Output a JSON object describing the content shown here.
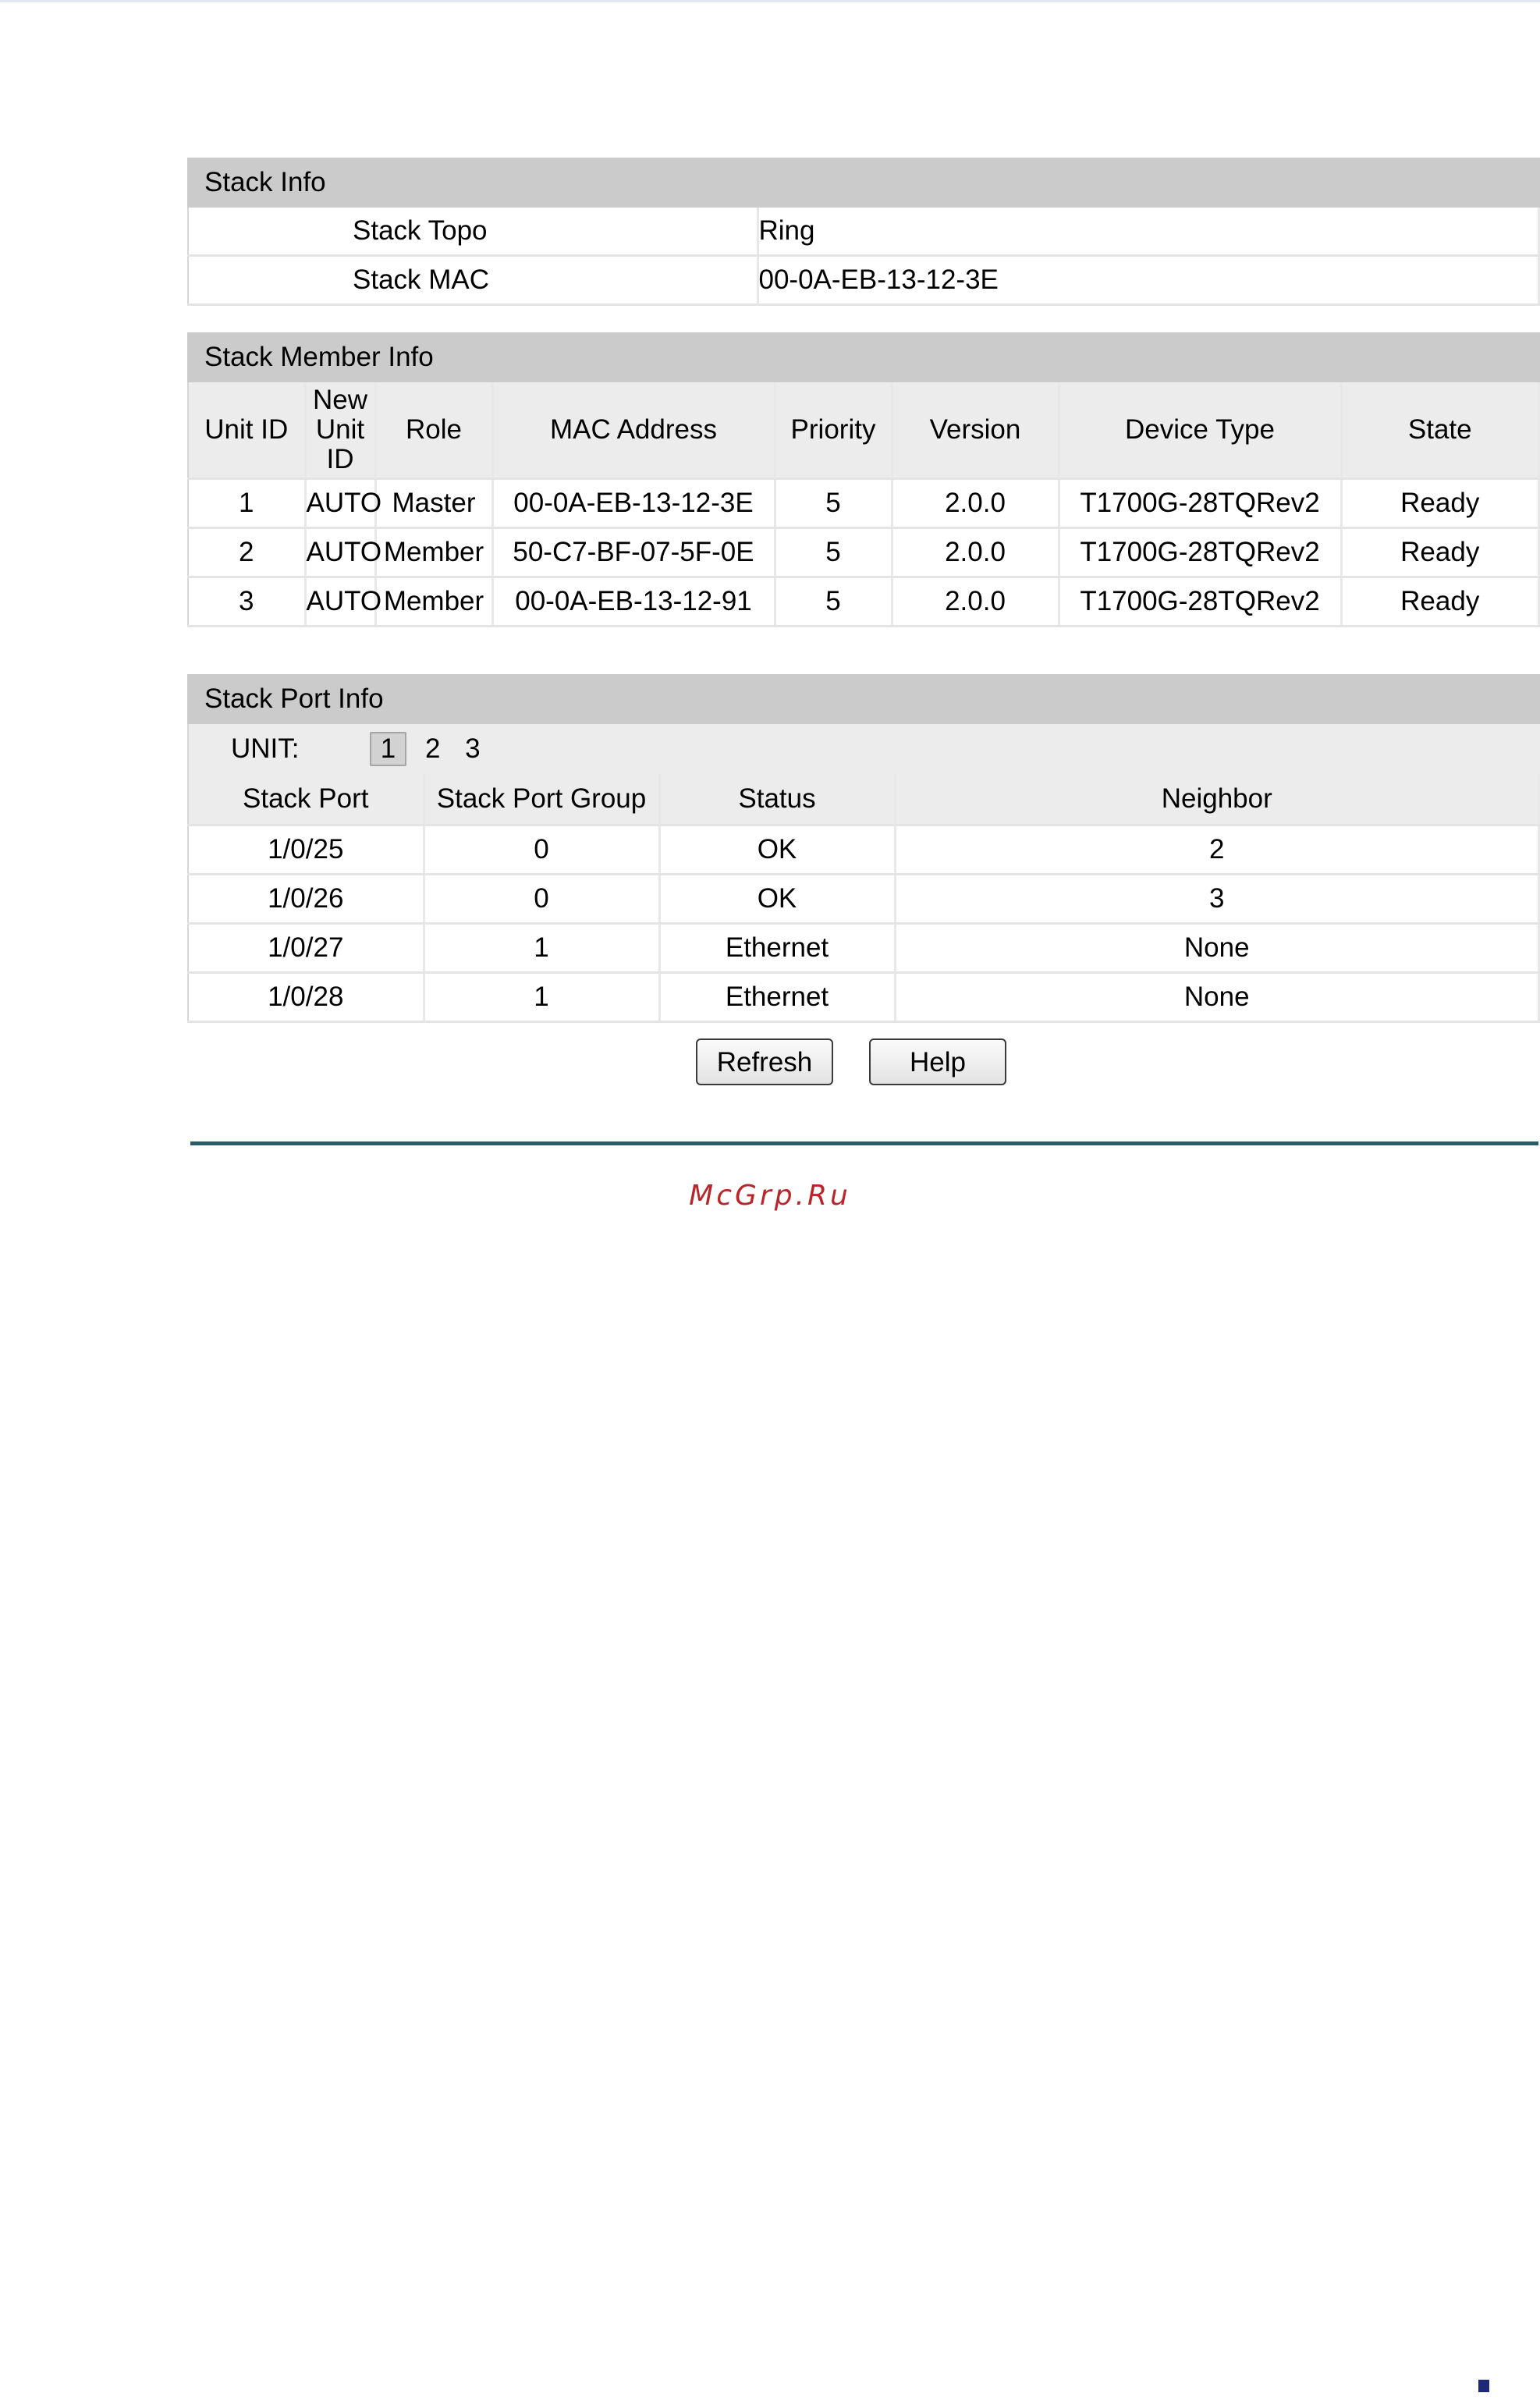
{
  "stack_info": {
    "title": "Stack Info",
    "rows": [
      {
        "label": "Stack Topo",
        "value": "Ring"
      },
      {
        "label": "Stack MAC",
        "value": "00-0A-EB-13-12-3E"
      }
    ]
  },
  "stack_member_info": {
    "title": "Stack Member Info",
    "columns": [
      "Unit ID",
      "New Unit ID",
      "Role",
      "MAC Address",
      "Priority",
      "Version",
      "Device Type",
      "State"
    ],
    "rows": [
      [
        "1",
        "AUTO",
        "Master",
        "00-0A-EB-13-12-3E",
        "5",
        "2.0.0",
        "T1700G-28TQRev2",
        "Ready"
      ],
      [
        "2",
        "AUTO",
        "Member",
        "50-C7-BF-07-5F-0E",
        "5",
        "2.0.0",
        "T1700G-28TQRev2",
        "Ready"
      ],
      [
        "3",
        "AUTO",
        "Member",
        "00-0A-EB-13-12-91",
        "5",
        "2.0.0",
        "T1700G-28TQRev2",
        "Ready"
      ]
    ]
  },
  "stack_port_info": {
    "title": "Stack Port Info",
    "unit_label": "UNIT:",
    "units": [
      "1",
      "2",
      "3"
    ],
    "columns": [
      "Stack Port",
      "Stack Port Group",
      "Status",
      "Neighbor"
    ],
    "rows": [
      [
        "1/0/25",
        "0",
        "OK",
        "2"
      ],
      [
        "1/0/26",
        "0",
        "OK",
        "3"
      ],
      [
        "1/0/27",
        "1",
        "Ethernet",
        "None"
      ],
      [
        "1/0/28",
        "1",
        "Ethernet",
        "None"
      ]
    ]
  },
  "buttons": {
    "refresh": "Refresh",
    "help": "Help"
  },
  "watermark": "McGrp.Ru"
}
